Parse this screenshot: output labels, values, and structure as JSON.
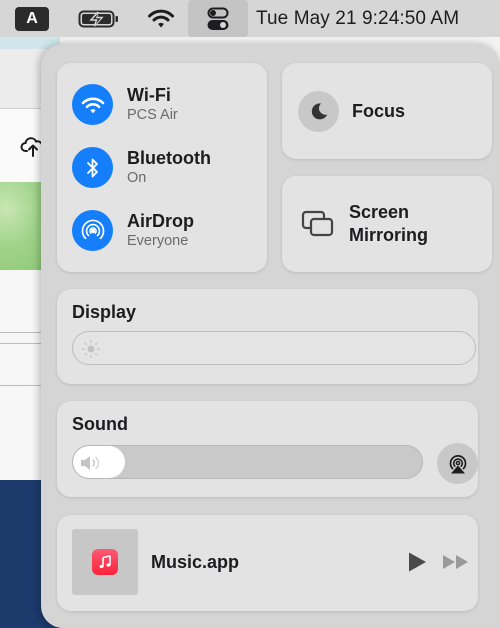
{
  "menubar": {
    "input_source_label": "A",
    "icons": [
      "input-source-icon",
      "battery-charging-icon",
      "wifi-icon",
      "control-center-icon"
    ],
    "clock": "Tue May 21  9:24:50 AM"
  },
  "control_center": {
    "connectivity": [
      {
        "id": "wifi",
        "title": "Wi-Fi",
        "subtitle": "PCS Air",
        "icon": "wifi-icon",
        "active": true
      },
      {
        "id": "bluetooth",
        "title": "Bluetooth",
        "subtitle": "On",
        "icon": "bluetooth-icon",
        "active": true
      },
      {
        "id": "airdrop",
        "title": "AirDrop",
        "subtitle": "Everyone",
        "icon": "airdrop-icon",
        "active": true
      }
    ],
    "focus": {
      "label": "Focus",
      "icon": "moon-icon"
    },
    "screen_mirroring": {
      "label_line1": "Screen",
      "label_line2": "Mirroring",
      "icon": "screen-mirroring-icon"
    },
    "display": {
      "title": "Display",
      "brightness_percent": 0,
      "icon": "sun-icon"
    },
    "sound": {
      "title": "Sound",
      "volume_percent": 15,
      "icon": "speaker-icon",
      "airplay_icon": "airplay-audio-icon"
    },
    "now_playing": {
      "app": "Music.app",
      "icon": "music-app-icon",
      "controls": [
        "play",
        "fast-forward"
      ]
    }
  },
  "colors": {
    "accent": "#147efb",
    "panel": "#d5d5d5",
    "tile": "#e3e3e3",
    "music_red": "#fa233b"
  }
}
